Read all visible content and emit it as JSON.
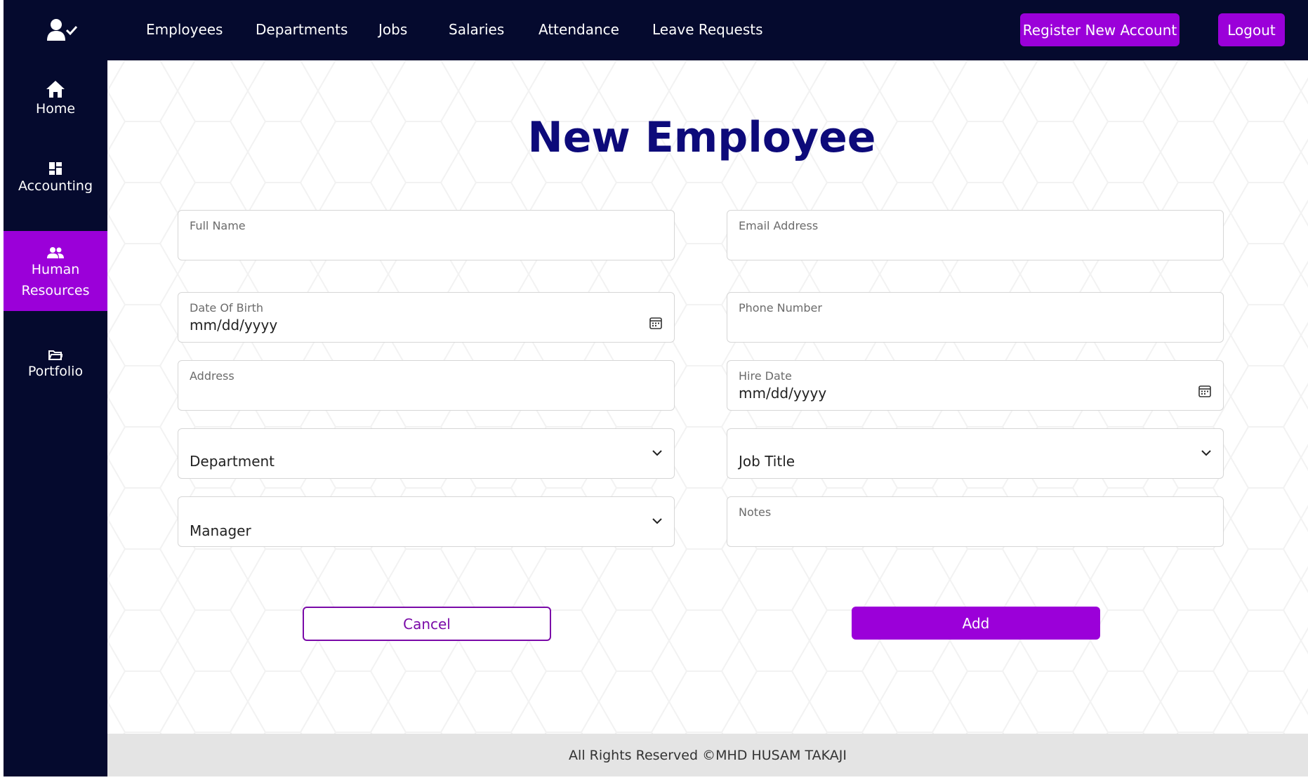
{
  "topnav": {
    "items": [
      {
        "label": "Employees"
      },
      {
        "label": "Departments"
      },
      {
        "label": "Jobs"
      },
      {
        "label": "Salaries"
      },
      {
        "label": "Attendance"
      },
      {
        "label": "Leave Requests"
      }
    ],
    "register_label": "Register New Account",
    "logout_label": "Logout",
    "logo_icon": "user-check-icon"
  },
  "sidebar": {
    "items": [
      {
        "label": "Home",
        "icon": "home-icon",
        "active": false
      },
      {
        "label": "Accounting",
        "icon": "dashboard-icon",
        "active": false
      },
      {
        "label": "Human Resources",
        "icon": "people-icon",
        "active": true
      },
      {
        "label": "Portfolio",
        "icon": "folder-icon",
        "active": false
      }
    ]
  },
  "form": {
    "title": "New Employee",
    "full_name_label": "Full Name",
    "email_label": "Email Address",
    "dob_label": "Date Of Birth",
    "dob_value": "mm/dd/yyyy",
    "phone_label": "Phone Number",
    "address_label": "Address",
    "hire_label": "Hire Date",
    "hire_value": "mm/dd/yyyy",
    "department_value": "Department",
    "job_title_value": "Job Title",
    "manager_value": "Manager",
    "notes_label": "Notes",
    "cancel_label": "Cancel",
    "add_label": "Add"
  },
  "footer": {
    "text": "All Rights Reserved ©MHD HUSAM TAKAJI"
  },
  "colors": {
    "navbar": "#050a2e",
    "accent": "#9b00d9",
    "title": "#0d0a7a",
    "footer": "#e4e4e4"
  }
}
